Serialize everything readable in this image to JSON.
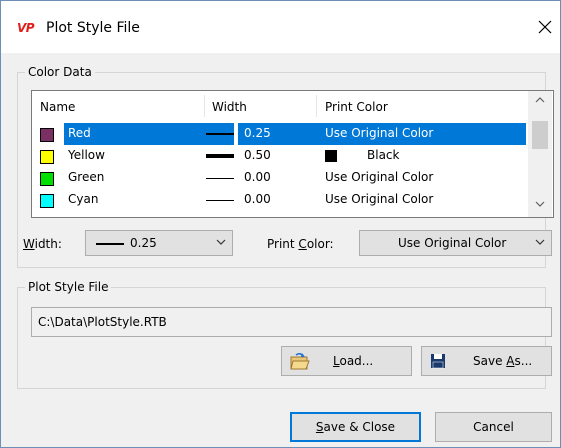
{
  "window": {
    "title": "Plot Style File",
    "app_icon_text": "VP"
  },
  "color_data": {
    "group_label": "Color Data",
    "columns": {
      "name": "Name",
      "width": "Width",
      "print_color": "Print Color"
    },
    "rows": [
      {
        "name": "Red",
        "swatch_color": "#7b2f62",
        "width": "0.25",
        "print_color": "Use Original Color",
        "selected": true,
        "print_swatch": false
      },
      {
        "name": "Yellow",
        "swatch_color": "#ffff00",
        "width": "0.50",
        "print_color": "Black",
        "selected": false,
        "print_swatch": true
      },
      {
        "name": "Green",
        "swatch_color": "#00e000",
        "width": "0.00",
        "print_color": "Use Original Color",
        "selected": false,
        "print_swatch": false
      },
      {
        "name": "Cyan",
        "swatch_color": "#00ffff",
        "width": "0.00",
        "print_color": "Use Original Color",
        "selected": false,
        "print_swatch": false
      }
    ]
  },
  "width_control": {
    "label_accel": "W",
    "label_rest": "idth:",
    "value": "0.25"
  },
  "print_color_control": {
    "label_pre": "Print ",
    "label_accel": "C",
    "label_post": "olor:",
    "value": "Use Original Color"
  },
  "plot_style_file": {
    "group_label": "Plot Style File",
    "path": "C:\\Data\\PlotStyle.RTB"
  },
  "buttons": {
    "load_accel": "L",
    "load_rest": "oad...",
    "save_as_pre": "Save ",
    "save_as_accel": "A",
    "save_as_post": "s...",
    "save_close_accel": "S",
    "save_close_rest": "ave & Close",
    "cancel": "Cancel"
  },
  "colors": {
    "selection": "#0078d7",
    "window_border": "#6d8fb5",
    "icon_red": "#e0201b"
  }
}
